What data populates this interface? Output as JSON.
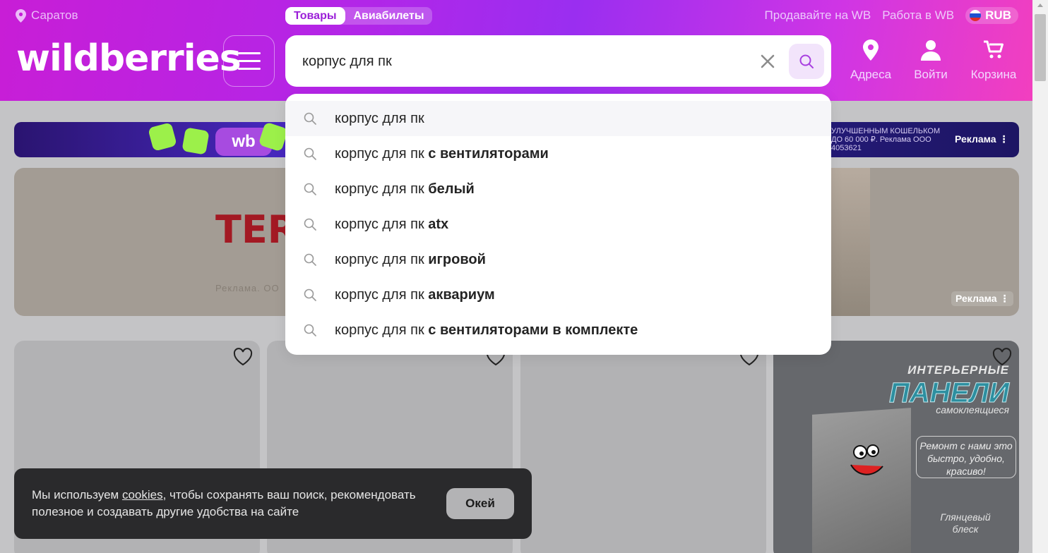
{
  "header": {
    "city": "Саратов",
    "tabs": [
      {
        "label": "Товары",
        "active": true
      },
      {
        "label": "Авиабилеты",
        "active": false
      }
    ],
    "top_links": [
      "Продавайте на WB",
      "Работа в WB"
    ],
    "currency": "RUB",
    "logo": "wildberries",
    "nav": [
      {
        "label": "Адреса",
        "icon": "map-pin-icon"
      },
      {
        "label": "Войти",
        "icon": "user-icon"
      },
      {
        "label": "Корзина",
        "icon": "cart-icon"
      }
    ]
  },
  "search": {
    "value": "корпус для пк",
    "suggestions": [
      {
        "base": "корпус для пк",
        "bold": ""
      },
      {
        "base": "корпус для пк",
        "bold": "с вентиляторами"
      },
      {
        "base": "корпус для пк",
        "bold": "белый"
      },
      {
        "base": "корпус для пк",
        "bold": "atx"
      },
      {
        "base": "корпус для пк",
        "bold": "игровой"
      },
      {
        "base": "корпус для пк",
        "bold": "аквариум"
      },
      {
        "base": "корпус для пк",
        "bold": "с вентиляторами в комплекте"
      }
    ]
  },
  "promo": {
    "fine_print": [
      "УЛУЧШЕННЫМ КОШЕЛЬКОМ",
      "ДО 60 000 ₽. Реклама ООО",
      "4053621"
    ],
    "ad_label": "Реклама ⋮",
    "badge": "wb"
  },
  "banner": {
    "brand": "TER",
    "fine_print": "Реклама. ОО",
    "ad_label": "Реклама ⋮"
  },
  "product_ad": {
    "line1": "ИНТЕРЬЕРНЫЕ",
    "line2": "ПАНЕЛИ",
    "line3": "самоклеящиеся",
    "bubble": "Ремонт с нами это быстро, удобно, красиво!",
    "footer": "Глянцевый блеск"
  },
  "cookie": {
    "text_before": "Мы используем ",
    "link": "cookies",
    "text_after": ", чтобы сохранять ваш поиск, рекомендовать полезное и создавать другие удобства на сайте",
    "button": "Окей"
  },
  "colors": {
    "brand_purple": "#9b1fd8",
    "search_btn_bg": "#f2e4fb"
  }
}
